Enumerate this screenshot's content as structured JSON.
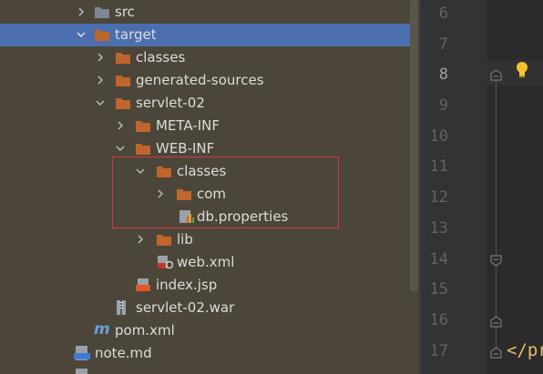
{
  "tree": {
    "items": [
      {
        "label": "src",
        "icon": "folder-icon",
        "chevron": "right"
      },
      {
        "label": "target",
        "icon": "folder-icon",
        "chevron": "down",
        "selected": true
      },
      {
        "label": "classes",
        "icon": "folder-icon",
        "chevron": "right"
      },
      {
        "label": "generated-sources",
        "icon": "folder-icon",
        "chevron": "right"
      },
      {
        "label": "servlet-02",
        "icon": "folder-icon",
        "chevron": "down"
      },
      {
        "label": "META-INF",
        "icon": "folder-icon",
        "chevron": "right"
      },
      {
        "label": "WEB-INF",
        "icon": "folder-icon",
        "chevron": "down"
      },
      {
        "label": "classes",
        "icon": "folder-icon",
        "chevron": "down"
      },
      {
        "label": "com",
        "icon": "folder-icon",
        "chevron": "right"
      },
      {
        "label": "db.properties",
        "icon": "properties-file-icon"
      },
      {
        "label": "lib",
        "icon": "folder-icon",
        "chevron": "right"
      },
      {
        "label": "web.xml",
        "icon": "xml-config-file-icon"
      },
      {
        "label": "index.jsp",
        "icon": "jsp-file-icon"
      },
      {
        "label": "servlet-02.war",
        "icon": "war-archive-icon"
      },
      {
        "label": "pom.xml",
        "icon": "maven-icon"
      },
      {
        "label": "note.md",
        "icon": "markdown-file-icon"
      }
    ]
  },
  "gutter": {
    "lines": [
      "6",
      "7",
      "8",
      "9",
      "10",
      "11",
      "12",
      "13",
      "14",
      "15",
      "16",
      "17"
    ],
    "active_line": "8"
  },
  "editor": {
    "line17_code": "</pr"
  },
  "colors": {
    "folder": "#c0652e",
    "selection": "#4b6eaf",
    "highlight_border": "#d23b3b",
    "panel_bg": "#4b4639"
  }
}
